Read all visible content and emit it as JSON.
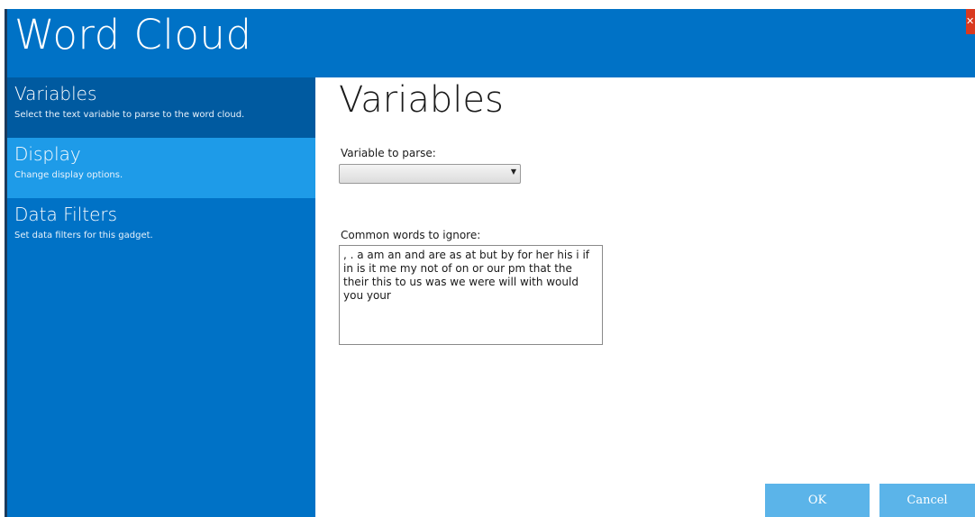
{
  "window": {
    "title": "Word Cloud",
    "close_icon": "close-icon",
    "close_glyph": "✕"
  },
  "sidebar": {
    "items": [
      {
        "title": "Variables",
        "description": "Select the text variable to parse to the word cloud."
      },
      {
        "title": "Display",
        "description": "Change display options."
      },
      {
        "title": "Data Filters",
        "description": "Set data filters for this gadget."
      }
    ]
  },
  "main": {
    "title": "Variables",
    "variable_label": "Variable to parse:",
    "variable_value": "",
    "ignore_label": "Common words to ignore:",
    "ignore_text": ", . a am an and are as at but by for her his i if in is it me my not of on or our pm that the their this to us was we were will with would you your"
  },
  "buttons": {
    "ok": "OK",
    "cancel": "Cancel"
  },
  "colors": {
    "header": "#0072c6",
    "sidebar": "#0072c6",
    "sidebar_active": "#005aa0",
    "sidebar_highlight": "#1e9be8",
    "button": "#5bb4e9"
  }
}
